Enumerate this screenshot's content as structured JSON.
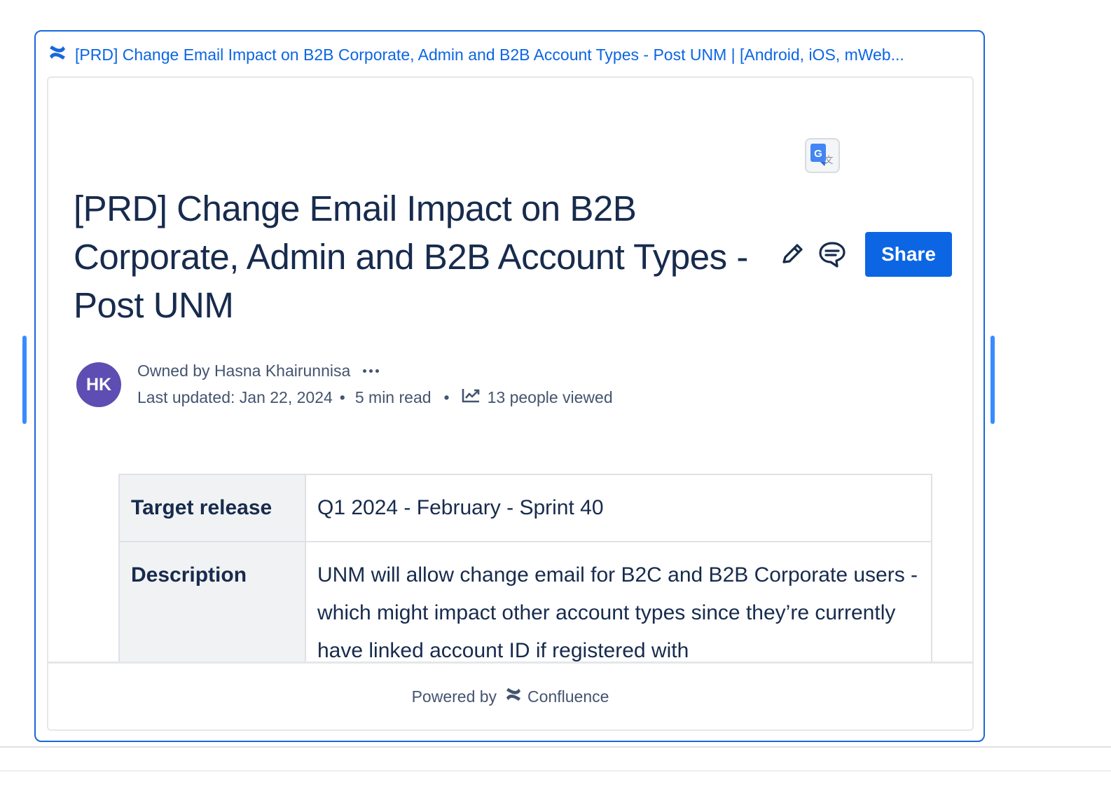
{
  "card": {
    "link_title": "[PRD] Change Email Impact on B2B Corporate, Admin and B2B Account Types - Post UNM | [Android, iOS, mWeb..."
  },
  "page": {
    "title": "[PRD] Change Email Impact on B2B Corporate, Admin and B2B Account Types - Post UNM",
    "share_label": "Share",
    "avatar_initials": "HK",
    "owner_text": "Owned by Hasna Khairunnisa",
    "last_updated": "Last updated: Jan 22, 2024",
    "read_time": "5 min read",
    "views": "13 people viewed",
    "separator": "•"
  },
  "properties": [
    {
      "label": "Target release",
      "value": "Q1 2024 - February - Sprint 40"
    },
    {
      "label": "Description",
      "value": "UNM will allow change email for B2C and B2B Corporate users - which might impact other account types since they’re currently have linked account ID if registered with"
    }
  ],
  "footer": {
    "powered_by": "Powered by",
    "brand": "Confluence"
  },
  "icons": {
    "confluence": "confluence-logo-icon",
    "translate": "google-translate-icon",
    "edit": "pencil-icon",
    "comment": "comment-icon",
    "more": "more-horizontal-icon",
    "views": "analytics-trend-icon"
  },
  "colors": {
    "link": "#0c66e4",
    "primary_button": "#0c66e4",
    "avatar": "#5e4db2",
    "card_border": "#1868db"
  }
}
